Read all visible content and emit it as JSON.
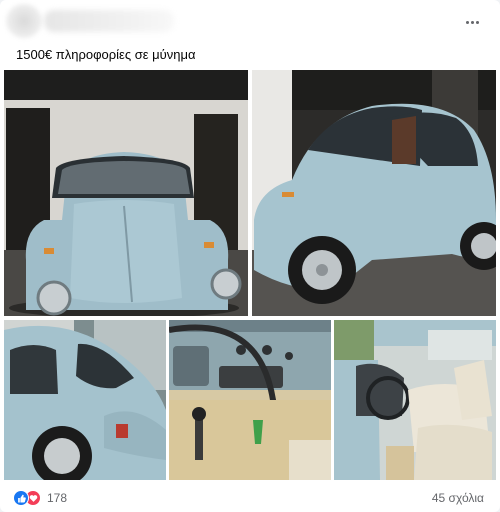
{
  "post": {
    "caption": "1500€ πληροφορίες σε μύνημα",
    "more_icon": "more-horizontal-icon",
    "photos": [
      {
        "name": "photo-front-garage"
      },
      {
        "name": "photo-side-garage"
      },
      {
        "name": "photo-rear-closeup"
      },
      {
        "name": "photo-dashboard"
      },
      {
        "name": "photo-interior-seats"
      }
    ],
    "reactions": {
      "icons": [
        "like-icon",
        "love-icon"
      ],
      "count": "178"
    },
    "comments_label": "45 σχόλια"
  },
  "colors": {
    "car_blue": "#a9c7d2",
    "accent_blue": "#1877f2",
    "love_red": "#f33e58",
    "muted_text": "#65676b"
  }
}
